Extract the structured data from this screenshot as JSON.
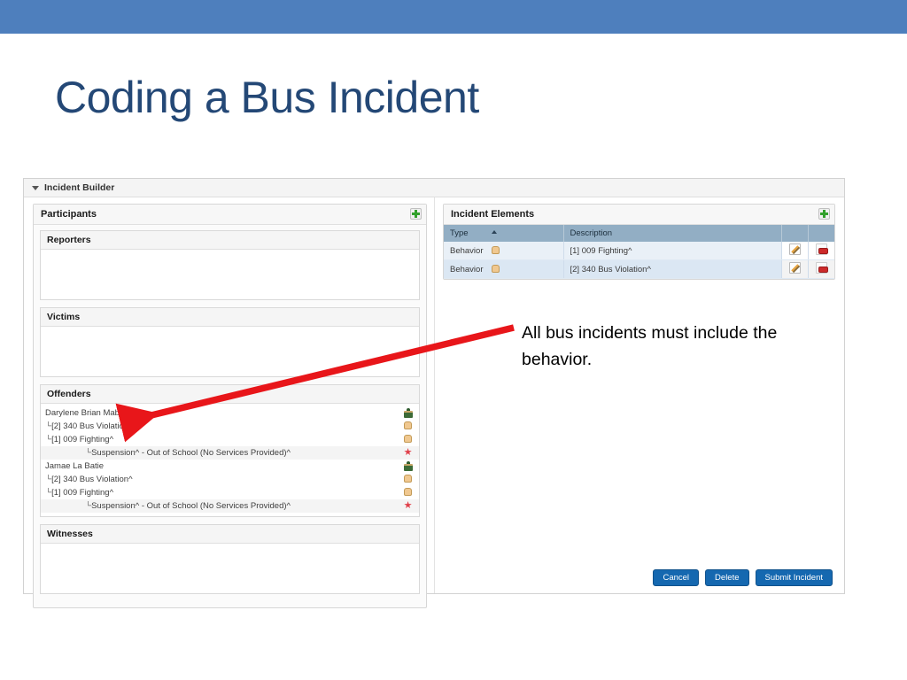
{
  "slide": {
    "title": "Coding a Bus Incident",
    "band_color": "#4e7fbd",
    "title_color": "#244876"
  },
  "app": {
    "panel_title": "Incident Builder",
    "caret_icon": "caret-down-icon"
  },
  "participants": {
    "title": "Participants",
    "add_icon": "plus-icon",
    "sections": [
      {
        "title": "Reporters",
        "items": []
      },
      {
        "title": "Victims",
        "items": []
      },
      {
        "title": "Offenders",
        "items": [
          {
            "label": "Darylene Brian Mabe",
            "indent": 1,
            "elbow": "",
            "icon": "person-icon",
            "shaded": false
          },
          {
            "label": "[2] 340 Bus Violation^",
            "indent": 1,
            "elbow": "└",
            "icon": "hand-icon",
            "shaded": false
          },
          {
            "label": "[1] 009 Fighting^",
            "indent": 1,
            "elbow": "└",
            "icon": "hand-icon",
            "shaded": false
          },
          {
            "label": "Suspension^ - Out of School (No Services Provided)^",
            "indent": 2,
            "elbow": "└",
            "icon": "star-icon",
            "shaded": true
          },
          {
            "label": "Jamae La Batie",
            "indent": 1,
            "elbow": "",
            "icon": "person-icon",
            "shaded": false
          },
          {
            "label": "[2] 340 Bus Violation^",
            "indent": 1,
            "elbow": "└",
            "icon": "hand-icon",
            "shaded": false
          },
          {
            "label": "[1] 009 Fighting^",
            "indent": 1,
            "elbow": "└",
            "icon": "hand-icon",
            "shaded": false
          },
          {
            "label": "Suspension^ - Out of School (No Services Provided)^",
            "indent": 2,
            "elbow": "└",
            "icon": "star-icon",
            "shaded": true
          }
        ]
      },
      {
        "title": "Witnesses",
        "items": []
      }
    ]
  },
  "incident_elements": {
    "title": "Incident Elements",
    "add_icon": "plus-icon",
    "columns": [
      "Type",
      "Description"
    ],
    "sort_column": "Type",
    "sort_direction": "asc",
    "rows": [
      {
        "type": "Behavior",
        "type_icon": "hand-icon",
        "description": "[1] 009 Fighting^",
        "edit_icon": "pencil-icon",
        "delete_icon": "minus-icon"
      },
      {
        "type": "Behavior",
        "type_icon": "hand-icon",
        "description": "[2] 340 Bus Violation^",
        "edit_icon": "pencil-icon",
        "delete_icon": "minus-icon"
      }
    ]
  },
  "annotation": {
    "text": "All bus incidents must include the behavior.",
    "arrow_color": "#e8161a"
  },
  "footer": {
    "buttons": [
      {
        "label": "Cancel"
      },
      {
        "label": "Delete"
      },
      {
        "label": "Submit Incident"
      }
    ],
    "button_color": "#1568b0"
  }
}
